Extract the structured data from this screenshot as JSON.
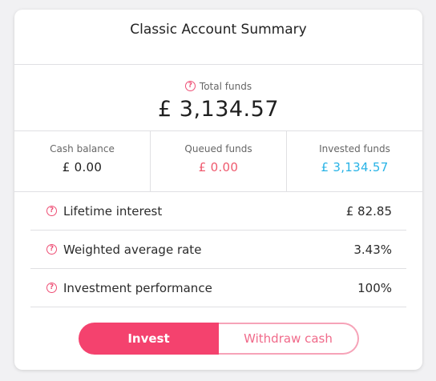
{
  "title": "Classic Account Summary",
  "total": {
    "label": "Total funds",
    "value": "£ 3,134.57"
  },
  "splits": [
    {
      "label": "Cash balance",
      "value": "£ 0.00",
      "color": "#1f1f1f"
    },
    {
      "label": "Queued funds",
      "value": "£ 0.00",
      "color": "#ef5a6e"
    },
    {
      "label": "Invested funds",
      "value": "£ 3,134.57",
      "color": "#28b3e6"
    }
  ],
  "rows": [
    {
      "label": "Lifetime interest",
      "value": "£ 82.85"
    },
    {
      "label": "Weighted average rate",
      "value": "3.43%"
    },
    {
      "label": "Investment performance",
      "value": "100%"
    }
  ],
  "buttons": {
    "invest": "Invest",
    "withdraw": "Withdraw cash"
  },
  "help_icon": "question-circle-icon",
  "accent": "#f4426e"
}
